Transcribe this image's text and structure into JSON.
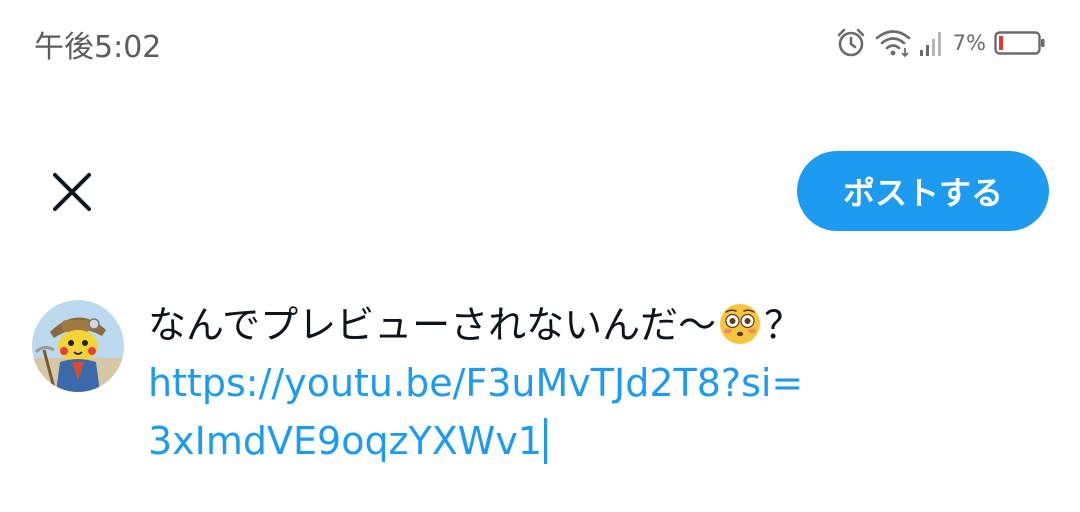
{
  "status_bar": {
    "time": "午後5:02",
    "battery_percent": "7%",
    "icons": [
      "alarm-icon",
      "wifi-icon",
      "signal-icon",
      "battery-icon"
    ],
    "battery_color": "#e53935"
  },
  "header": {
    "close_icon": "close-icon",
    "post_button_label": "ポストする",
    "accent": "#1d9bf0"
  },
  "composer": {
    "text_before_emoji": "なんでプレビューされないんだ〜",
    "emoji": "flushed-face-emoji",
    "text_after_emoji": "？",
    "link_line_1": "https://youtu.be/F3uMvTJd2T8?si=",
    "link_line_2": "3xImdVE9oqzYXWv1"
  }
}
